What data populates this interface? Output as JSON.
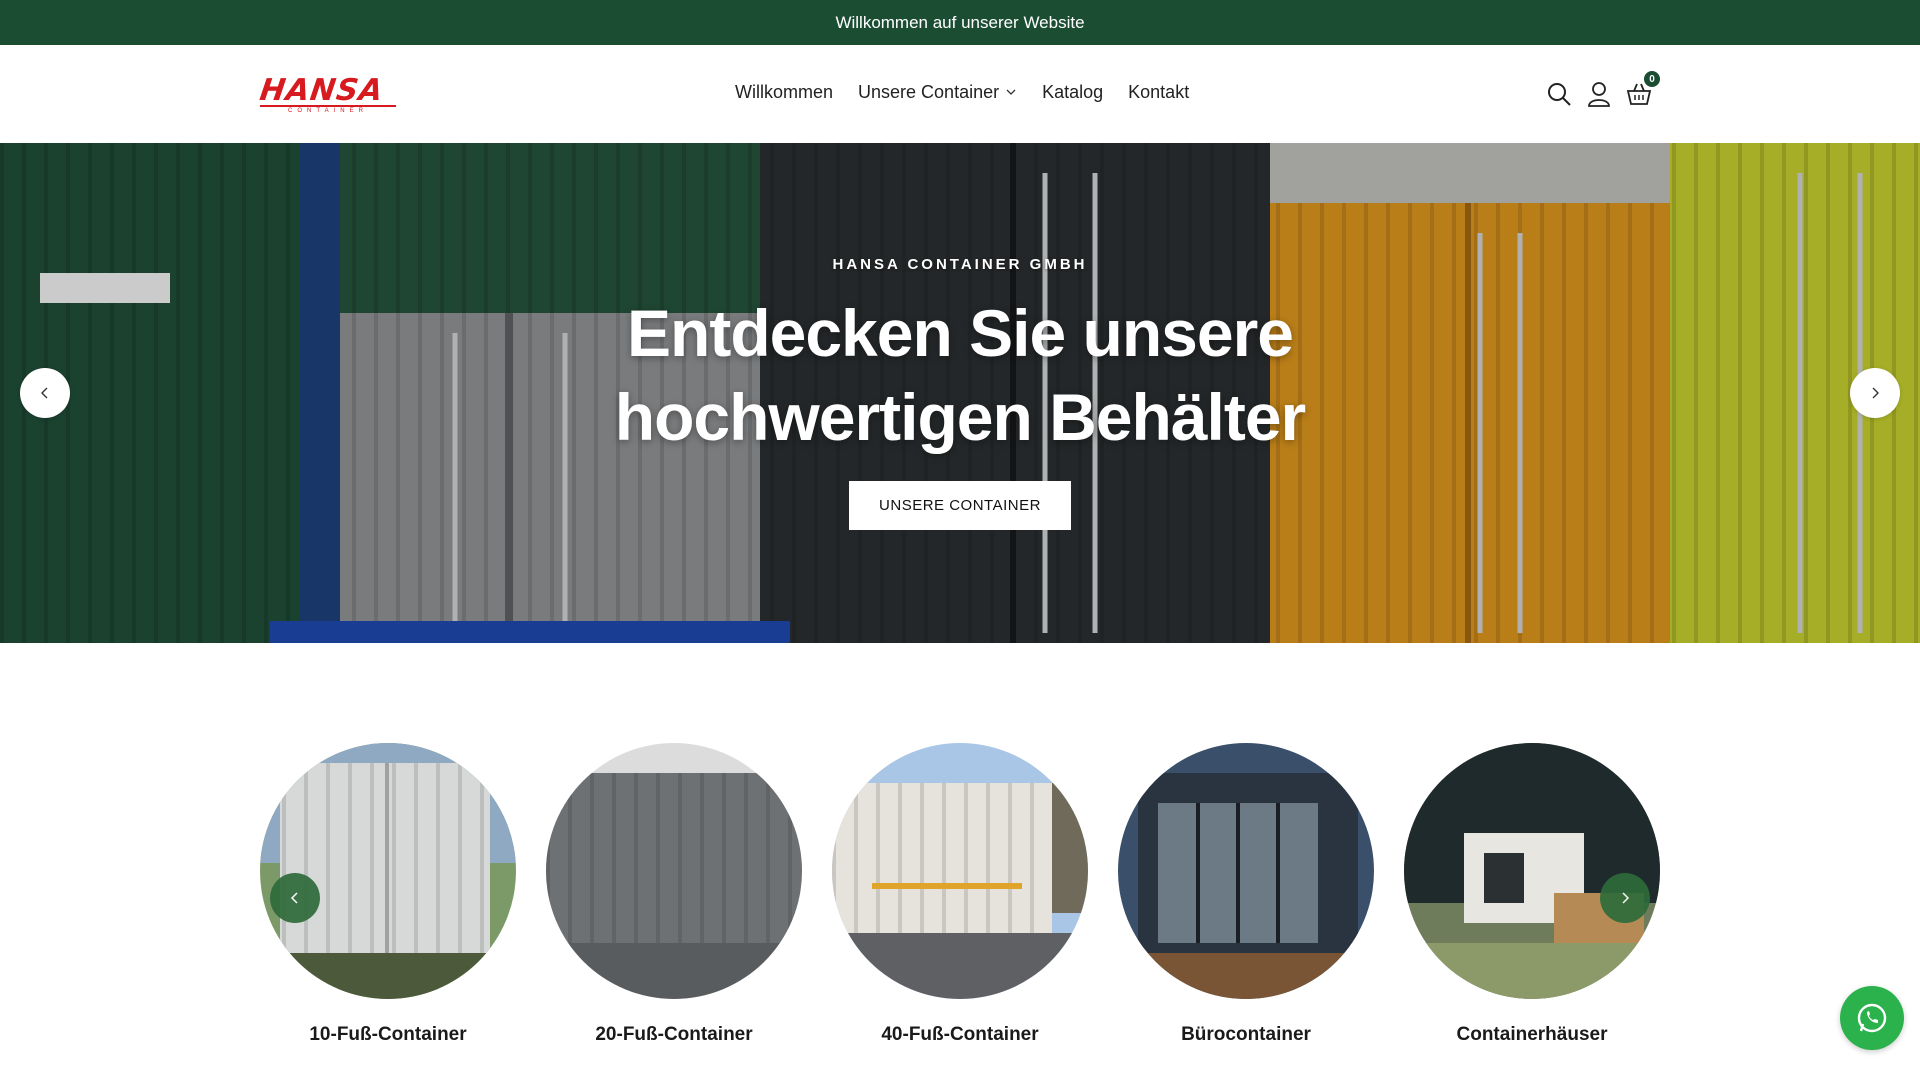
{
  "announcement": {
    "text": "Willkommen auf unserer Website"
  },
  "header": {
    "logo_text": "HANSA",
    "logo_sub": "CONTAINER",
    "nav": [
      {
        "label": "Willkommen"
      },
      {
        "label": "Unsere Container",
        "has_dropdown": true
      },
      {
        "label": "Katalog"
      },
      {
        "label": "Kontakt"
      }
    ],
    "icons": [
      "search-icon",
      "account-icon",
      "cart-icon"
    ],
    "cart_count": "0"
  },
  "hero": {
    "eyebrow": "HANSA CONTAINER GMBH",
    "title": "Entdecken Sie unsere hochwertigen Behälter",
    "button_label": "UNSERE CONTAINER"
  },
  "categories": [
    {
      "label": "10-Fuß-Container"
    },
    {
      "label": "20-Fuß-Container"
    },
    {
      "label": "40-Fuß-Container"
    },
    {
      "label": "Bürocontainer"
    },
    {
      "label": "Containerhäuser"
    }
  ],
  "colors": {
    "brand_green": "#1b4d33",
    "logo_red": "#d71920",
    "whatsapp_green": "#2bb24c"
  }
}
